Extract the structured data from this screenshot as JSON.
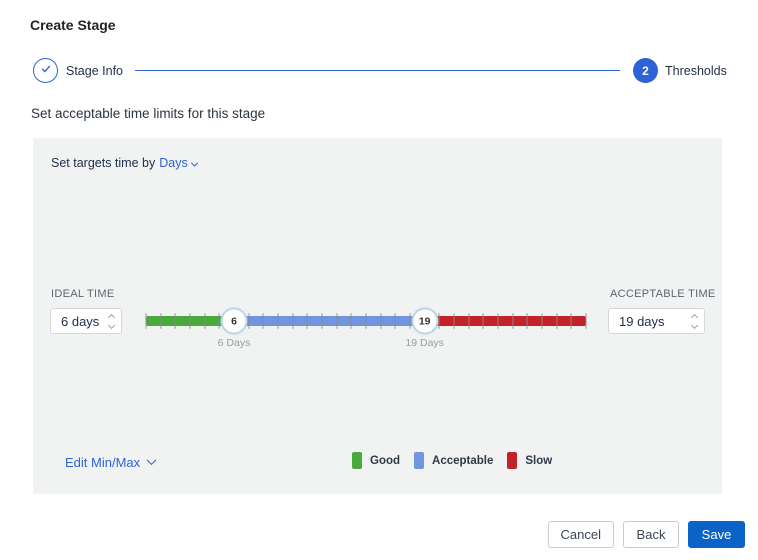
{
  "title": "Create Stage",
  "stepper": {
    "steps": [
      {
        "label": "Stage Info",
        "state": "completed",
        "icon": "check"
      },
      {
        "label": "Thresholds",
        "state": "current",
        "number": "2"
      }
    ]
  },
  "heading": "Set acceptable time limits for this stage",
  "panel": {
    "set_targets_prefix": "Set targets time by",
    "unit_dropdown": "Days",
    "ideal_label": "IDEAL TIME",
    "ideal_value": "6 days",
    "acceptable_label": "ACCEPTABLE TIME",
    "acceptable_value": "19 days",
    "edit_minmax": "Edit Min/Max"
  },
  "slider": {
    "min": 0,
    "max": 30,
    "tick_step": 1,
    "handles": [
      {
        "value": 6,
        "label": "6",
        "caption": "6 Days"
      },
      {
        "value": 19,
        "label": "19",
        "caption": "19 Days"
      }
    ],
    "segments": [
      {
        "name": "good",
        "color": "#4aa93c"
      },
      {
        "name": "acceptable",
        "color": "#7196dd"
      },
      {
        "name": "slow",
        "color": "#c2222a"
      }
    ]
  },
  "legend": [
    {
      "label": "Good",
      "color": "#4aa93c"
    },
    {
      "label": "Acceptable",
      "color": "#7196dd"
    },
    {
      "label": "Slow",
      "color": "#c2222a"
    }
  ],
  "footer": {
    "cancel": "Cancel",
    "back": "Back",
    "save": "Save"
  },
  "colors": {
    "accent_blue": "#2e63d6",
    "save_blue": "#0a64c8",
    "panel_bg": "#f1f2f2"
  }
}
